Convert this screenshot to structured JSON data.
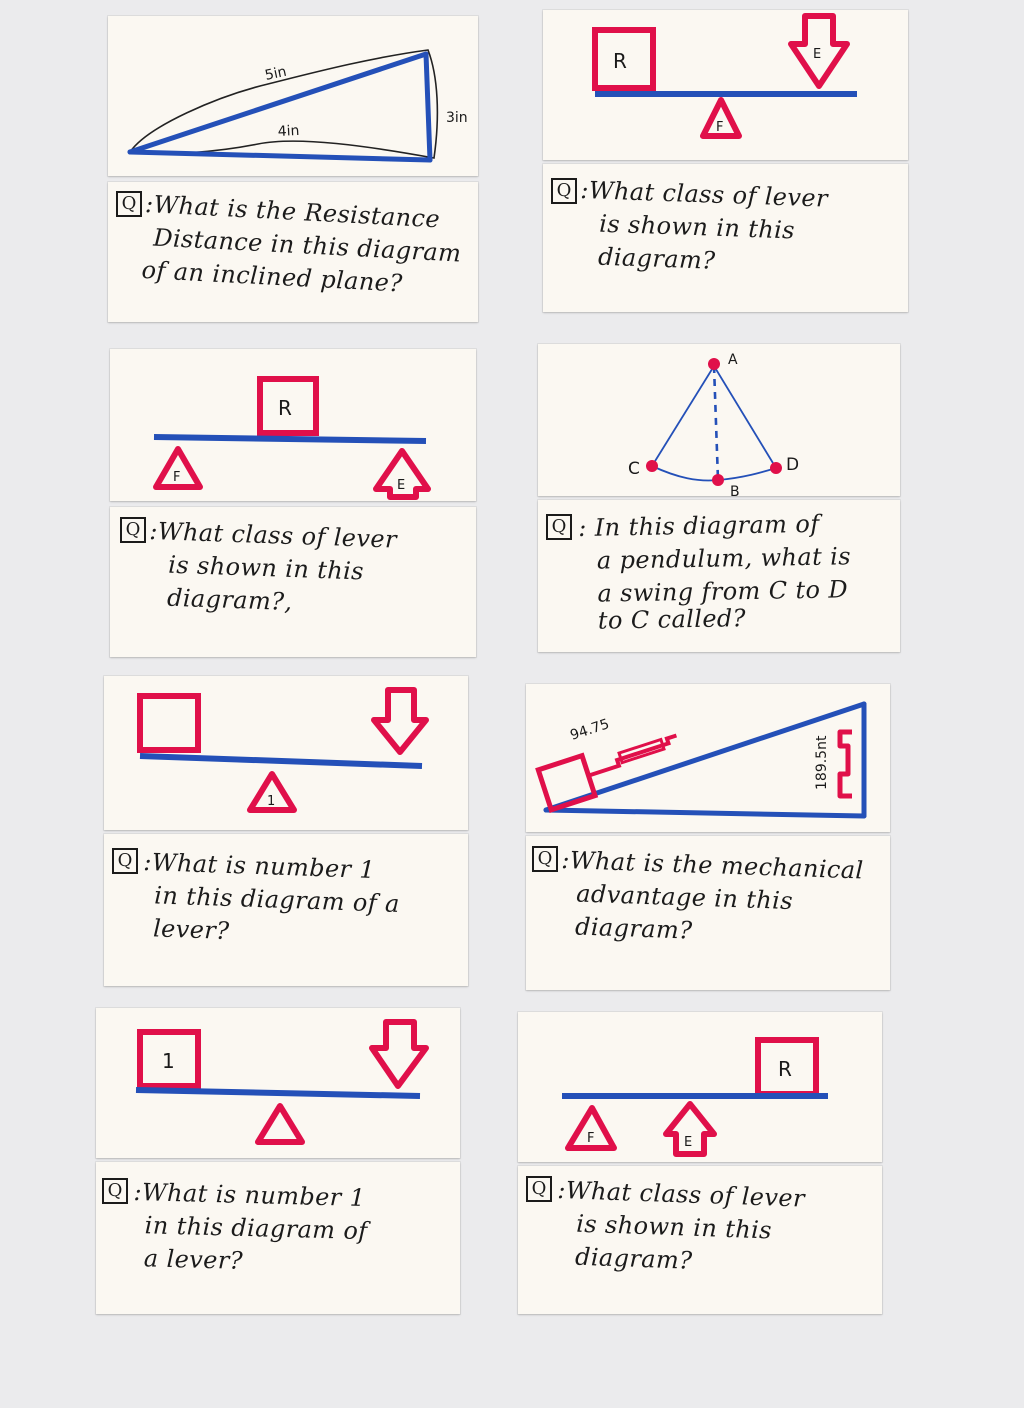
{
  "colors": {
    "blue": "#2450b8",
    "red": "#e0104a",
    "ink": "#1b1b1b",
    "card": "#fbf8f2",
    "background": "#ebebed"
  },
  "question_marker": "Q",
  "cards": [
    {
      "id": "inclined-plane",
      "figure": {
        "type": "inclined-plane",
        "labels": {
          "hypotenuse": "5in",
          "base": "4in",
          "height": "3in"
        }
      },
      "question_lines": [
        ":What is the Resistance",
        "Distance in this diagram",
        "of an inclined plane?"
      ]
    },
    {
      "id": "lever-class-1",
      "figure": {
        "type": "lever",
        "labels": {
          "resistance": "R",
          "effort": "E",
          "fulcrum": "F"
        }
      },
      "question_lines": [
        ":What class of lever",
        "is shown in this",
        "diagram?"
      ]
    },
    {
      "id": "lever-class-2",
      "figure": {
        "type": "lever",
        "labels": {
          "resistance": "R",
          "effort": "E",
          "fulcrum": "F"
        }
      },
      "question_lines": [
        ":What class of lever",
        "is shown in this",
        "diagram?,"
      ]
    },
    {
      "id": "pendulum",
      "figure": {
        "type": "pendulum",
        "labels": {
          "top": "A",
          "left": "C",
          "right": "D",
          "bottom": "B"
        }
      },
      "question_lines": [
        ": In this diagram of",
        "a pendulum, what is",
        "a swing from C to D",
        "to C called?"
      ]
    },
    {
      "id": "lever-number-1-fulcrum",
      "figure": {
        "type": "lever",
        "labels": {
          "fulcrum": "1"
        }
      },
      "question_lines": [
        ":What is number 1",
        "in this diagram of a",
        "lever?"
      ]
    },
    {
      "id": "mechanical-advantage",
      "figure": {
        "type": "inclined-plane",
        "labels": {
          "slope": "94.75",
          "height": "189.5nt"
        }
      },
      "question_lines": [
        ":What is the mechanical",
        "advantage in this",
        "diagram?"
      ]
    },
    {
      "id": "lever-number-1-resistance",
      "figure": {
        "type": "lever",
        "labels": {
          "resistance": "1"
        }
      },
      "question_lines": [
        ":What is number 1",
        "in this diagram of",
        "a lever?"
      ]
    },
    {
      "id": "lever-class-3",
      "figure": {
        "type": "lever",
        "labels": {
          "resistance": "R",
          "effort": "E",
          "fulcrum": "F"
        }
      },
      "question_lines": [
        ":What class of lever",
        "is shown in this",
        "diagram?"
      ]
    }
  ]
}
